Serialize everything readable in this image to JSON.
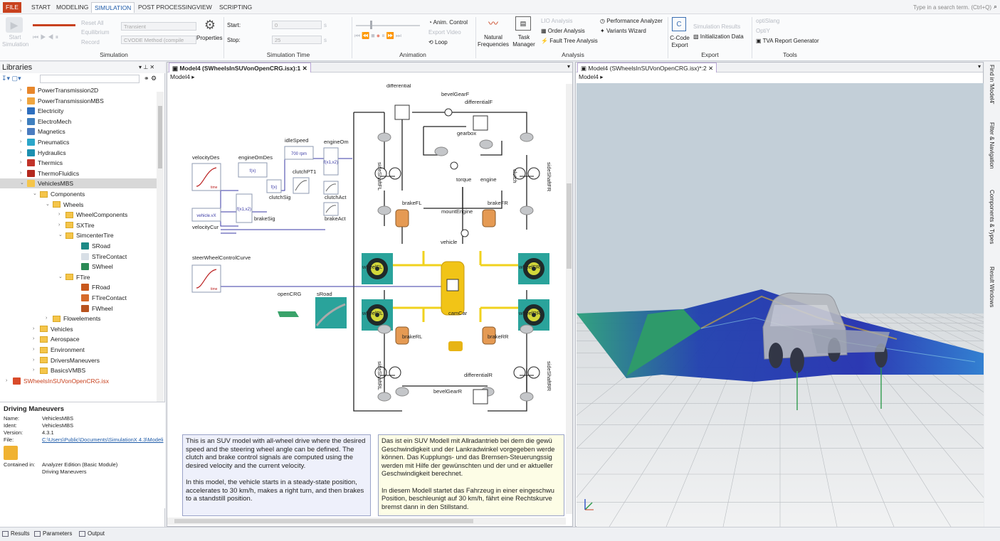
{
  "menu": {
    "items": [
      "FILE",
      "START",
      "MODELING",
      "SIMULATION",
      "POST PROCESSING",
      "VIEW",
      "SCRIPTING"
    ],
    "active": "SIMULATION",
    "search_placeholder": "Type in a search term. (Ctrl+Q)"
  },
  "ribbon": {
    "simulation": {
      "start_label": "Start Simulation",
      "reset_all": "Reset All",
      "equilibrium": "Equilibrium",
      "record": "Record",
      "mode": "Transient",
      "method": "CVODE Method (compile",
      "properties": "Properties",
      "group": "Simulation"
    },
    "time": {
      "start_label": "Start:",
      "start_value": "0",
      "start_unit": "s",
      "stop_label": "Stop:",
      "stop_value": "25",
      "stop_unit": "s",
      "group": "Simulation Time"
    },
    "animation": {
      "anim_control": "Anim. Control",
      "export_video": "Export Video",
      "loop": "Loop",
      "group": "Animation"
    },
    "analysis": {
      "natural_frequencies": "Natural Frequencies",
      "task_manager": "Task Manager",
      "lio": "LIO Analysis",
      "order": "Order Analysis",
      "fault_tree": "Fault Tree Analysis",
      "performance": "Performance Analyzer",
      "variants": "Variants Wizard",
      "group": "Analysis"
    },
    "export": {
      "ccode": "C-Code Export",
      "sim_results": "Simulation Results",
      "init_data": "Initialization Data",
      "group": "Export"
    },
    "tools": {
      "optislang": "optiSlang",
      "optiy": "OptiY",
      "tva": "TVA Report Generator",
      "group": "Tools"
    }
  },
  "libraries": {
    "title": "Libraries",
    "items": [
      {
        "label": "PowerTransmission2D",
        "color": "#e8872b"
      },
      {
        "label": "PowerTransmissionMBS",
        "color": "#f0a640"
      },
      {
        "label": "Electricity",
        "color": "#2e6fbf"
      },
      {
        "label": "ElectroMech",
        "color": "#3f7fbf"
      },
      {
        "label": "Magnetics",
        "color": "#4a7cc0"
      },
      {
        "label": "Pneumatics",
        "color": "#2ba6c9"
      },
      {
        "label": "Hydraulics",
        "color": "#1c8fb0"
      },
      {
        "label": "Thermics",
        "color": "#c1332a"
      },
      {
        "label": "ThermoFluidics",
        "color": "#b4281e"
      },
      {
        "label": "VehiclesMBS",
        "color": "#f5c54a"
      },
      {
        "label": "Components",
        "color": "#f5c54a"
      },
      {
        "label": "Wheels",
        "color": "#f5c54a"
      },
      {
        "label": "WheelComponents",
        "color": "#f5c54a"
      },
      {
        "label": "SXTire",
        "color": "#f5c54a"
      },
      {
        "label": "SimcenterTire",
        "color": "#f5c54a"
      },
      {
        "label": "SRoad",
        "color": "#1d8a86"
      },
      {
        "label": "STireContact",
        "color": "#d8dfe6"
      },
      {
        "label": "SWheel",
        "color": "#2b8a55"
      },
      {
        "label": "FTire",
        "color": "#f5c54a"
      },
      {
        "label": "FRoad",
        "color": "#c8581c"
      },
      {
        "label": "FTireContact",
        "color": "#d66a2a"
      },
      {
        "label": "FWheel",
        "color": "#b8531e"
      },
      {
        "label": "Flowelements",
        "color": "#f5c54a"
      },
      {
        "label": "Vehicles",
        "color": "#f5c54a"
      },
      {
        "label": "Aerospace",
        "color": "#f5c54a"
      },
      {
        "label": "Environment",
        "color": "#f5c54a"
      },
      {
        "label": "DriversManeuvers",
        "color": "#f5c54a"
      },
      {
        "label": "BasicsVMBS",
        "color": "#f5c54a"
      },
      {
        "label": "SWheelsInSUVonOpenCRG.isx",
        "color": "#d94b2a"
      }
    ]
  },
  "properties": {
    "title": "Driving Maneuvers",
    "name_label": "Name:",
    "name": "VehiclesMBS",
    "ident_label": "Ident:",
    "ident": "VehiclesMBS",
    "version_label": "Version:",
    "version": "4.3.1",
    "file_label": "File:",
    "file": "C:\\Users\\Public\\Documents\\SimulationX 4.3\\Modeli",
    "contained_label": "Contained in:",
    "contained1": "Analyzer Edition (Basic Module)",
    "contained2": "Driving Maneuvers"
  },
  "bottom_tabs": [
    "Results",
    "Parameters",
    "Output"
  ],
  "model_view": {
    "tab": "Model4 (SWheelsInSUVonOpenCRG.isx):1",
    "crumb": "Model4",
    "labels": {
      "velocityDes": "velocityDes",
      "engineOmDes": "engineOmDes",
      "idleSpeed": "idleSpeed",
      "engineOm": "engineOm",
      "clutchPT1": "clutchPT1",
      "clutchSig": "clutchSig",
      "clutchAct": "clutchAct",
      "brakeSig": "brakeSig",
      "brakeAct": "brakeAct",
      "velocityCur": "velocityCur",
      "steerWheelControlCurve": "steerWheelControlCurve",
      "openCRG": "openCRG",
      "sRoad": "sRoad",
      "differential": "differential",
      "bevelGearF": "bevelGearF",
      "differentialF": "differentialF",
      "gearbox": "gearbox",
      "clutch": "clutch",
      "torque": "torque",
      "engine": "engine",
      "brakeFL": "brakeFL",
      "brakeFR": "brakeFR",
      "mountEngine": "mountEngine",
      "vehicle": "vehicle",
      "wheelFL": "wheelFL",
      "wheelFR": "wheelFR",
      "wheelRL": "wheelRL",
      "wheelRR": "wheelRR",
      "camCar": "camCar",
      "brakeRL": "brakeRL",
      "brakeRR": "brakeRR",
      "differentialR": "differentialR",
      "bevelGearR": "bevelGearR",
      "sideShaftFL": "sideShaftFL",
      "sideShaftFR": "sideShaftFR",
      "sideShaftRL": "sideShaftRL",
      "sideShaftRR": "sideShaftRR",
      "idle_value": "700 rpm",
      "velocity_value": "vehicle.vX",
      "fx": "f(x)",
      "fx1x2": "f(x1,x2)",
      "time": "time"
    },
    "desc_en": "This is an SUV model with all-wheel drive where the desired speed and the steering wheel angle can be defined. The clutch and brake control signals are computed using the desired velocity and the current velocity.\n\nIn this model, the vehicle starts in a steady-state position, accelerates to 30 km/h, makes a right turn, and then brakes to a standstill position.",
    "desc_de": "Das ist ein SUV Modell mit Allradantrieb bei dem die gewü\nGeschwindigkeit und der Lankradwinkel vorgegeben werde\nkönnen. Das Kupplungs- und das Bremsen-Steuerungssig\nwerden mit Hilfe der gewünschten und der und er aktueller\nGeschwindigkeit berechnet.\n\nIn diesem Modell startet das Fahrzeug in einer eingeschwu\nPosition, beschleunigt auf 30 km/h, fährt eine Rechtskurve\nbremst dann in den Stillstand."
  },
  "view3d": {
    "tab": "Model4 (SWheelsInSUVonOpenCRG.isx)*:2",
    "crumb": "Model4"
  },
  "side_tabs": [
    "Find in 'Model4'",
    "Filter & Navigation",
    "Components & Types",
    "Result Windows"
  ]
}
